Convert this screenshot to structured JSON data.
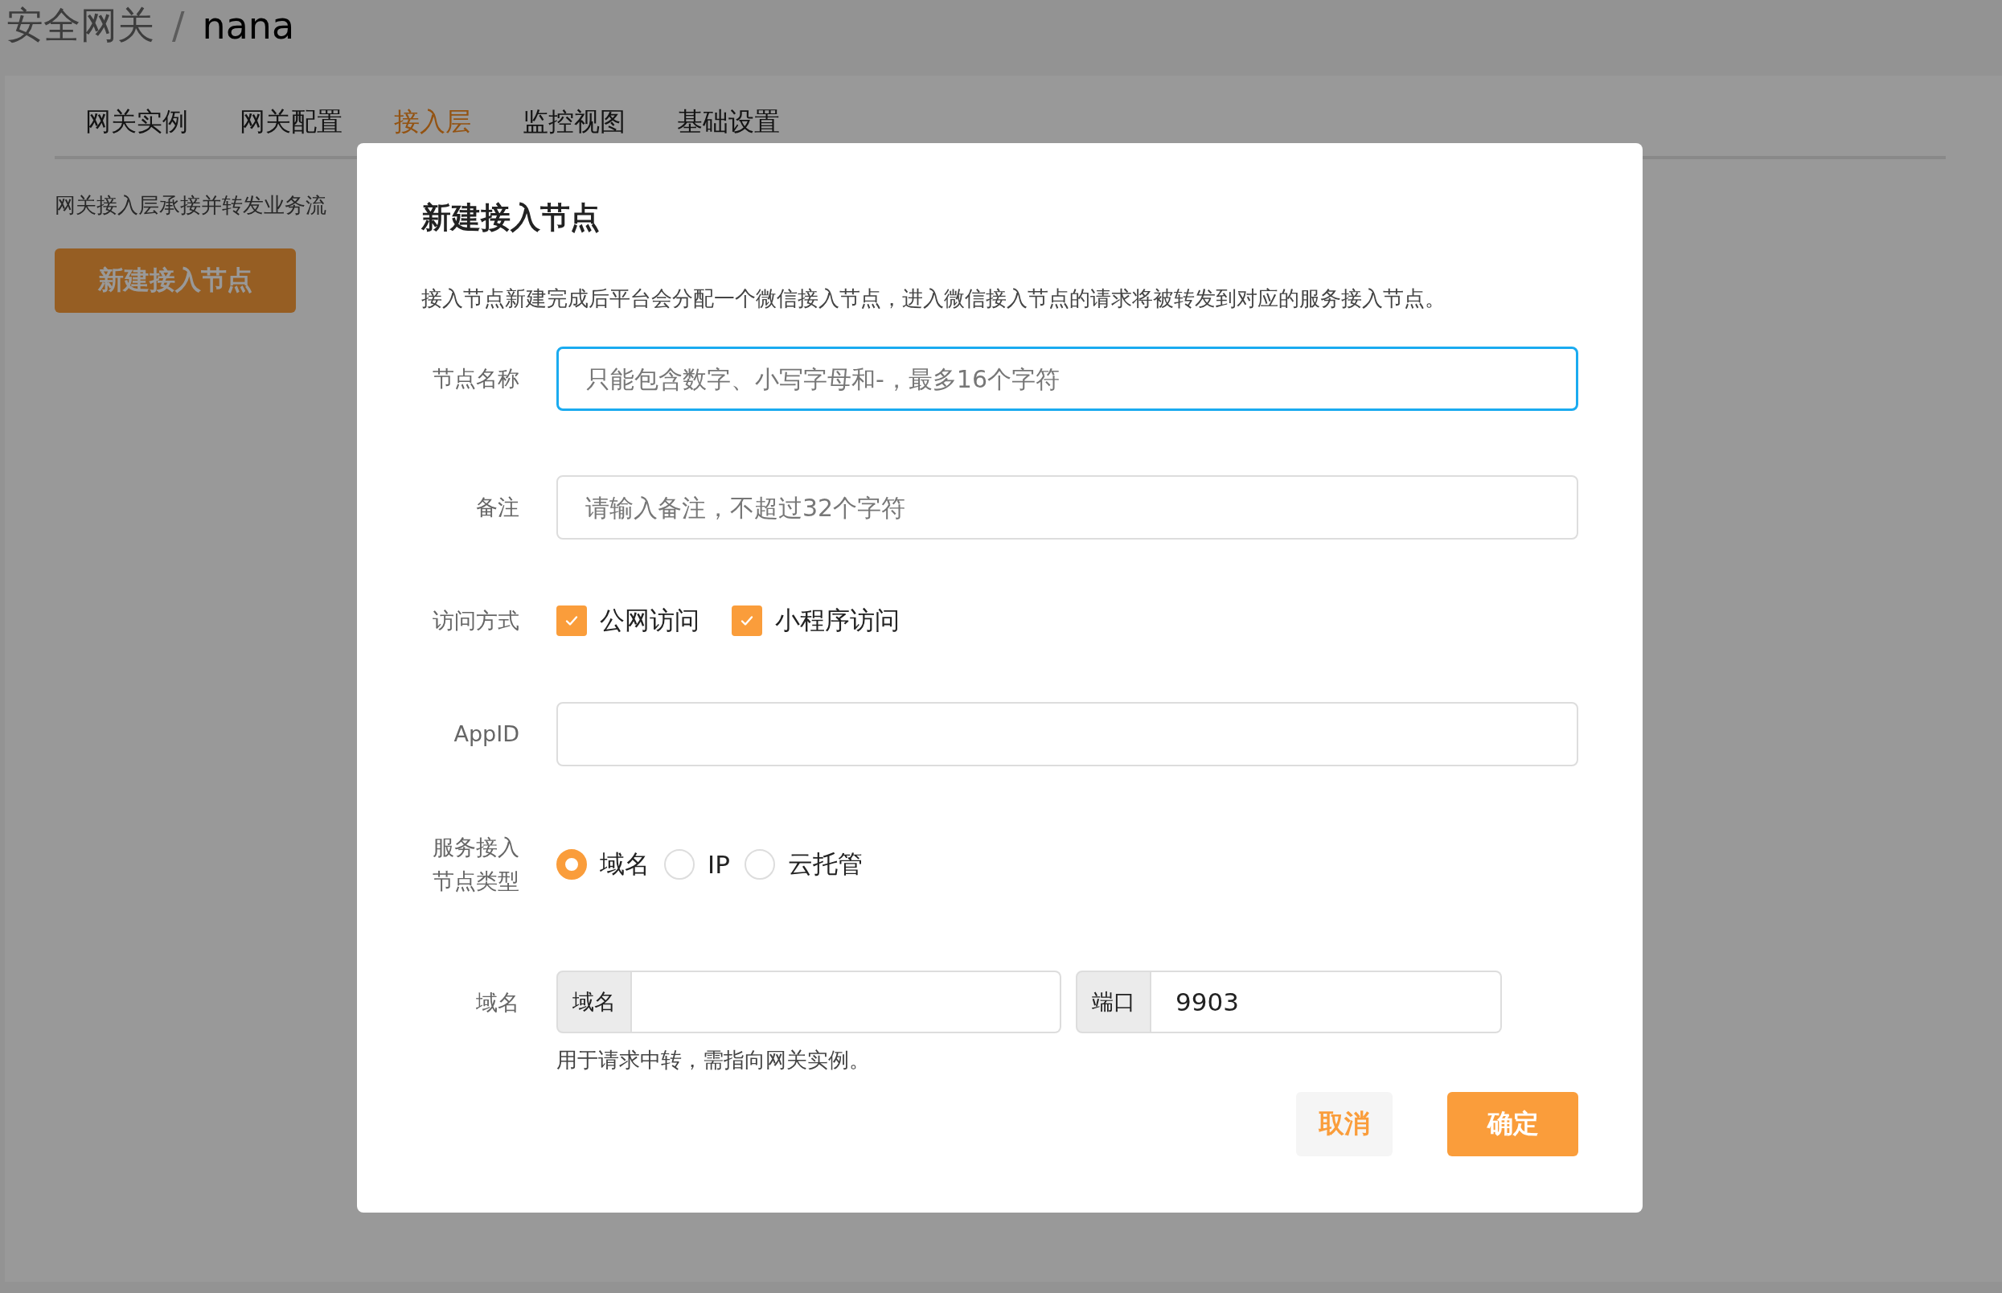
{
  "breadcrumb": {
    "parent": "安全网关",
    "separator": "/",
    "current": "nana"
  },
  "tabs": [
    {
      "label": "网关实例",
      "selected": false
    },
    {
      "label": "网关配置",
      "selected": false
    },
    {
      "label": "接入层",
      "selected": true
    },
    {
      "label": "监控视图",
      "selected": false
    },
    {
      "label": "基础设置",
      "selected": false
    }
  ],
  "page": {
    "description": "网关接入层承接并转发业务流",
    "create_button": "新建接入节点"
  },
  "dialog": {
    "title": "新建接入节点",
    "description": "接入节点新建完成后平台会分配一个微信接入节点，进入微信接入节点的请求将被转发到对应的服务接入节点。",
    "fields": [
      {
        "kind": "text",
        "label": "节点名称",
        "placeholder": "只能包含数字、小写字母和-，最多16个字符",
        "focused": true
      },
      {
        "kind": "text",
        "label": "备注",
        "placeholder": "请输入备注，不超过32个字符",
        "focused": false
      },
      {
        "kind": "checkbox",
        "label": "访问方式",
        "options": [
          {
            "label": "公网访问",
            "checked": true
          },
          {
            "label": "小程序访问",
            "checked": true
          }
        ]
      },
      {
        "kind": "text",
        "label": "AppID",
        "focused": false
      },
      {
        "kind": "radio",
        "label": "服务接入节点类型",
        "options": [
          {
            "label": "域名",
            "selected": true
          },
          {
            "label": "IP",
            "selected": false
          },
          {
            "label": "云托管",
            "selected": false
          }
        ]
      },
      {
        "kind": "addon",
        "label": "域名",
        "groups": [
          {
            "addon": "域名"
          },
          {
            "addon": "端口",
            "value": "9903"
          }
        ],
        "hint": "用于请求中转，需指向网关实例。"
      }
    ],
    "buttons": [
      {
        "label": "取消",
        "kind": "secondary"
      },
      {
        "label": "确定",
        "kind": "primary"
      }
    ]
  }
}
